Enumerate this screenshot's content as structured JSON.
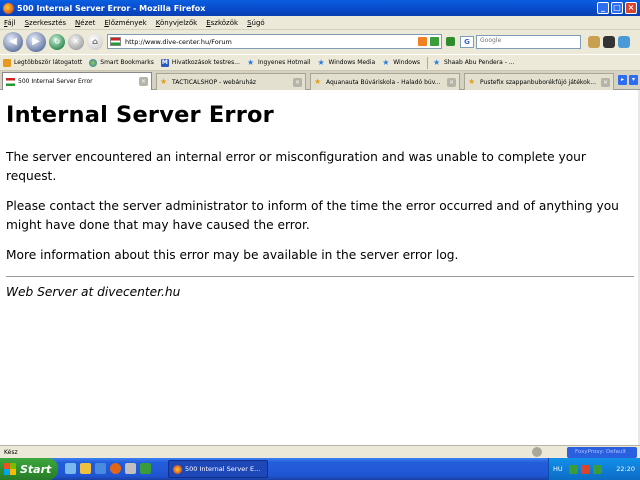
{
  "window": {
    "title": "500 Internal Server Error - Mozilla Firefox",
    "buttons": [
      "_",
      "□",
      "×"
    ]
  },
  "menu": [
    "Fájl",
    "Szerkesztés",
    "Nézet",
    "Előzmények",
    "Könyvjelzők",
    "Eszközök",
    "Súgó"
  ],
  "nav": {
    "url": "http://www.dive-center.hu/Forum",
    "search_placeholder": "Google",
    "search_engine_letter": "G"
  },
  "bookmarks": [
    {
      "label": "Legtöbbször látogatott",
      "icon": "folder-icon"
    },
    {
      "label": "Smart Bookmarks",
      "icon": "globe-icon"
    },
    {
      "label": "Hivatkozások testres...",
      "icon": "hotmail-icon"
    },
    {
      "label": "Ingyenes Hotmail",
      "icon": "star-icon"
    },
    {
      "label": "Windows Media",
      "icon": "star-icon"
    },
    {
      "label": "Windows",
      "icon": "star-icon"
    },
    {
      "label": "Shaab Abu Pendera - ...",
      "icon": "star-icon"
    }
  ],
  "tabs": [
    {
      "label": "500 Internal Server Error",
      "active": true
    },
    {
      "label": "TACTICALSHOP - webáruház",
      "active": false
    },
    {
      "label": "Aquanauta Búváriskola - Haladó búv...",
      "active": false
    },
    {
      "label": "Pustefix szappanbuborékfújó játékok...",
      "active": false
    }
  ],
  "page": {
    "heading": "Internal Server Error",
    "paragraphs": [
      "The server encountered an internal error or misconfiguration and was unable to complete your request.",
      "Please contact the server administrator to inform of the time the error occurred and of anything you might have done that may have caused the error.",
      "More information about this error may be available in the server error log."
    ],
    "footer": "Web Server at divecenter.hu"
  },
  "statusbar": {
    "text": "Kész",
    "proxy": "FoxyProxy: Default"
  },
  "taskbar": {
    "start_label": "Start",
    "task_label": "500 Internal Server E...",
    "language": "HU",
    "clock": "22:20"
  },
  "colors": {
    "titlebar": "#0a5fe0",
    "chrome": "#ece9d8",
    "taskbar": "#245edb",
    "start": "#2e8e2e",
    "tray": "#0f7ed8"
  }
}
